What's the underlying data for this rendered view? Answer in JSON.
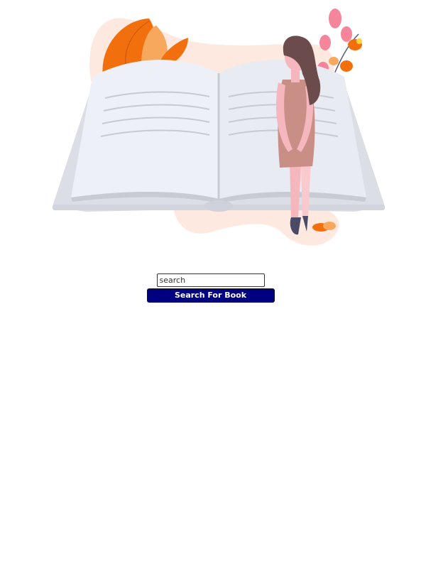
{
  "hero": {
    "illustration": "woman-reading-open-book-illustration",
    "colors": {
      "accent_orange": "#f26f0d",
      "light_orange": "#f7a85c",
      "pink": "#f5859b",
      "blob": "#fde9df",
      "book_page": "#eef0f7",
      "book_cover": "#dcdee6",
      "dress": "#c98f86",
      "hair": "#6b4b4b",
      "skin": "#f5b7bd",
      "shoes": "#4a4a66"
    }
  },
  "search": {
    "placeholder": "search",
    "value": "",
    "button_label": "Search For Book"
  },
  "theme": {
    "button_background": "#000080",
    "button_text": "#ffffff"
  }
}
